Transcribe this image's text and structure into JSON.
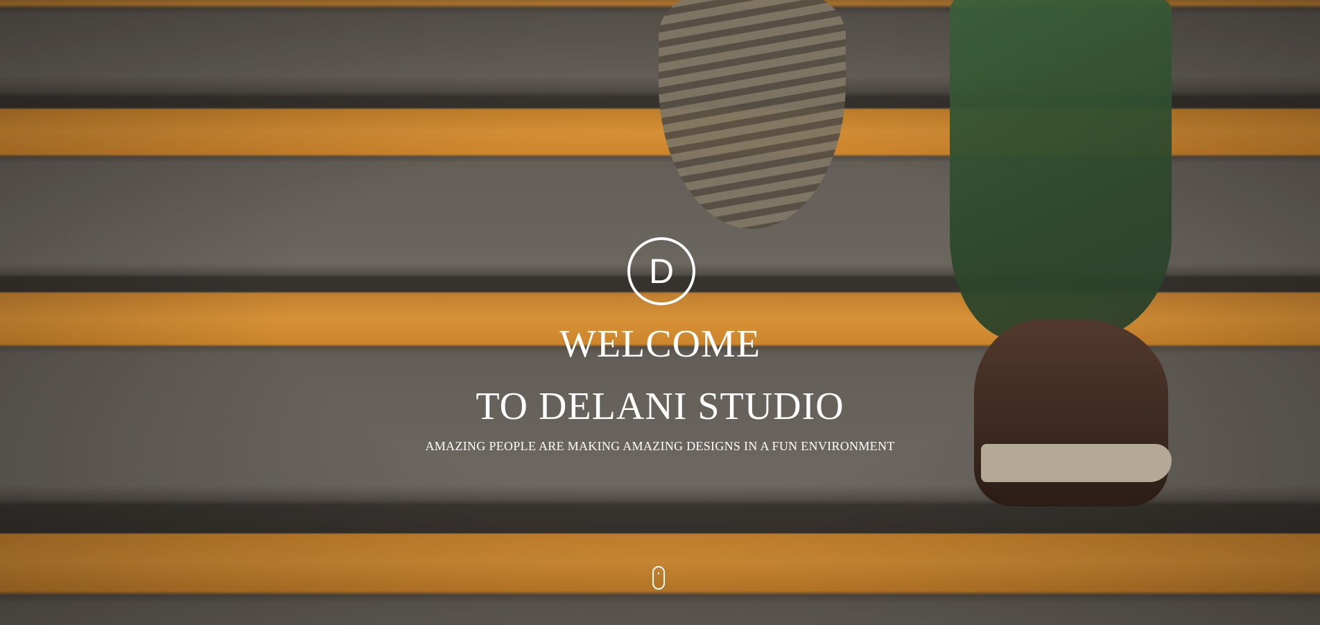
{
  "hero": {
    "logo_letter": "D",
    "title_line1": "WELCOME",
    "title_line2": "TO DELANI STUDIO",
    "subtitle": "AMAZING PEOPLE ARE MAKING AMAZING DESIGNS IN A FUN ENVIRONMENT",
    "scroll_icon": "mouse-scroll-icon"
  },
  "colors": {
    "text": "#ffffff",
    "stair_stripe": "#f0a03b",
    "stair_concrete": "#75706a"
  }
}
